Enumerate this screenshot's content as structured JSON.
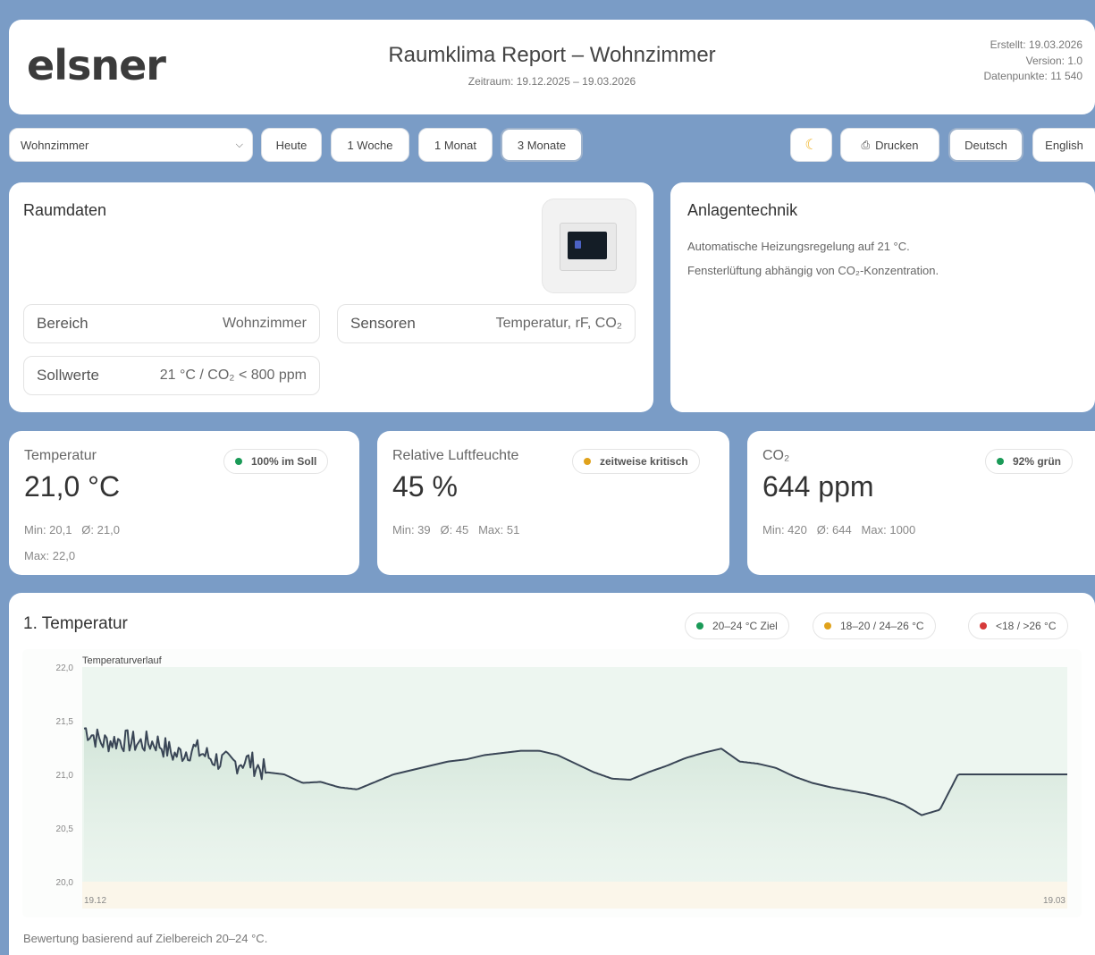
{
  "header": {
    "logo": "elsner",
    "title": "Raumklima Report – Wohnzimmer",
    "period": "Zeitraum: 19.12.2025 – 19.03.2026",
    "created": "Erstellt: 19.03.2026",
    "version": "Version: 1.0",
    "datapoints": "Datenpunkte: 11 540"
  },
  "toolbar": {
    "room_select": "Wohnzimmer",
    "ranges": [
      "Heute",
      "1 Woche",
      "1 Monat",
      "3 Monate"
    ],
    "active_range": "3 Monate",
    "theme_icon": "moon-icon",
    "print_label": "Drucken",
    "lang_de": "Deutsch",
    "lang_en": "English"
  },
  "raumdaten": {
    "title": "Raumdaten",
    "fields": [
      {
        "label": "Bereich",
        "value": "Wohnzimmer"
      },
      {
        "label": "Sensoren",
        "value": "Temperatur, rF, CO₂"
      },
      {
        "label": "Sollwerte",
        "value": "21 °C / CO₂ < 800 ppm"
      }
    ]
  },
  "anlagen": {
    "title": "Anlagentechnik",
    "line1": "Automatische Heizungsregelung auf 21 °C.",
    "line2": "Fensterlüftung abhängig von CO₂-Konzentration."
  },
  "kpis": [
    {
      "label": "Temperatur",
      "value": "21,0 °C",
      "stats1": "Min: 20,1   Ø: 21,0",
      "stats2": "Max: 22,0",
      "badge": "100% im Soll",
      "badge_color": "#1a9a57"
    },
    {
      "label": "Relative Luftfeuchte",
      "value": "45 %",
      "stats1": "Min: 39   Ø: 45   Max: 51",
      "badge": "zeitweise kritisch",
      "badge_color": "#e0a21b"
    },
    {
      "label": "CO₂",
      "value": "644 ppm",
      "stats1": "Min: 420   Ø: 644   Max: 1000",
      "badge": "92% grün",
      "badge_color": "#1a9a57"
    }
  ],
  "temperature": {
    "section_title": "1. Temperatur",
    "legend": [
      {
        "label": "20–24 °C Ziel",
        "color": "#1a9a57"
      },
      {
        "label": "18–20 / 24–26 °C",
        "color": "#e0a21b"
      },
      {
        "label": "<18 / >26 °C",
        "color": "#d63a3a"
      }
    ],
    "footnote": "Bewertung basierend auf Zielbereich 20–24 °C."
  },
  "chart_data": {
    "type": "line",
    "title": "Temperaturverlauf",
    "x_tick_labels": [
      "19.12",
      "19.03"
    ],
    "y_ticks": [
      "22,0",
      "21,5",
      "21,0",
      "20,5",
      "20,0"
    ],
    "ylim": [
      20.0,
      22.0
    ],
    "grid": false,
    "line_color": "#3a4656",
    "fill_color": "#e6f2ea",
    "series": [
      {
        "values": [
          21.43,
          21.3,
          21.32,
          21.29,
          21.3,
          21.18,
          21.24,
          21.15,
          21.1,
          21.13,
          21.02,
          21.0,
          20.92,
          20.93,
          20.88,
          20.86,
          20.93,
          21.0,
          21.04,
          21.08,
          21.12,
          21.14,
          21.18,
          21.2,
          21.22,
          21.22,
          21.18,
          21.1,
          21.02,
          20.96,
          20.95,
          21.02,
          21.08,
          21.15,
          21.2,
          21.24,
          21.12,
          21.1,
          21.06,
          20.98,
          20.92,
          20.88,
          20.85,
          20.82,
          20.78,
          20.72,
          20.62,
          20.67,
          21.0,
          21.0,
          21.0,
          21.0,
          21.0,
          21.0,
          21.0
        ]
      }
    ]
  }
}
